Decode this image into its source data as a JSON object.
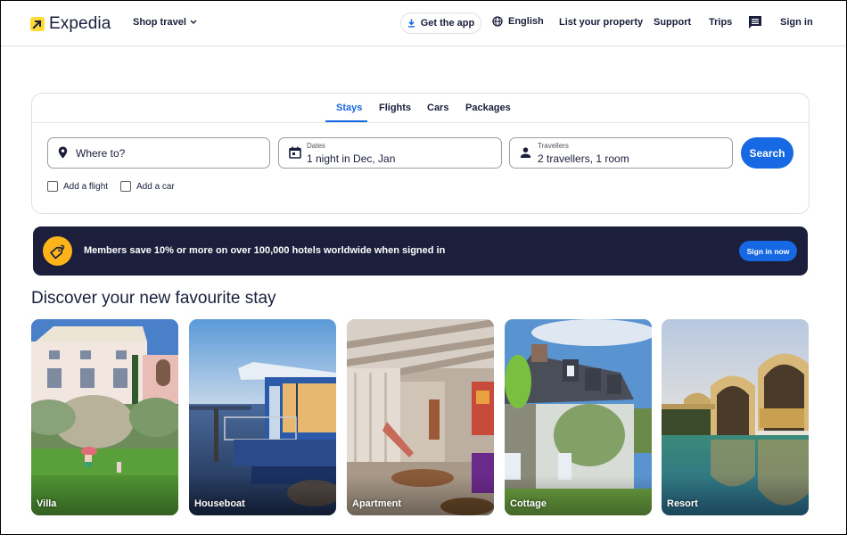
{
  "header": {
    "brand": "Expedia",
    "shop_travel": "Shop travel",
    "get_app": "Get the app",
    "language": "English",
    "list_property": "List your property",
    "support": "Support",
    "trips": "Trips",
    "sign_in": "Sign in",
    "icons": {
      "logo": "arrow-up-right-icon",
      "download": "download-icon",
      "globe": "globe-icon",
      "chat": "chat-icon",
      "chevron": "chevron-down-icon"
    }
  },
  "search": {
    "tabs": [
      {
        "label": "Stays",
        "active": true
      },
      {
        "label": "Flights",
        "active": false
      },
      {
        "label": "Cars",
        "active": false
      },
      {
        "label": "Packages",
        "active": false
      }
    ],
    "destination": {
      "placeholder": "Where to?",
      "icon": "map-pin-icon"
    },
    "dates": {
      "label": "Dates",
      "value": "1 night in Dec, Jan",
      "icon": "calendar-icon"
    },
    "travellers": {
      "label": "Travellers",
      "value": "2 travellers, 1 room",
      "icon": "person-icon"
    },
    "search_button": "Search",
    "add_flight": {
      "label": "Add a flight",
      "checked": false
    },
    "add_car": {
      "label": "Add a car",
      "checked": false
    }
  },
  "banner": {
    "text": "Members save 10% or more on over 100,000 hotels worldwide when signed in",
    "button": "Sign in now",
    "icon": "price-tag-icon"
  },
  "discover": {
    "title": "Discover your new favourite stay",
    "cards": [
      {
        "label": "Villa"
      },
      {
        "label": "Houseboat"
      },
      {
        "label": "Apartment"
      },
      {
        "label": "Cottage"
      },
      {
        "label": "Resort"
      }
    ]
  },
  "colors": {
    "brand_yellow": "#fddb32",
    "primary_blue": "#1668e3",
    "navy": "#191e3b",
    "banner_bg": "#1b1f3b",
    "banner_icon": "#fdb31a"
  }
}
